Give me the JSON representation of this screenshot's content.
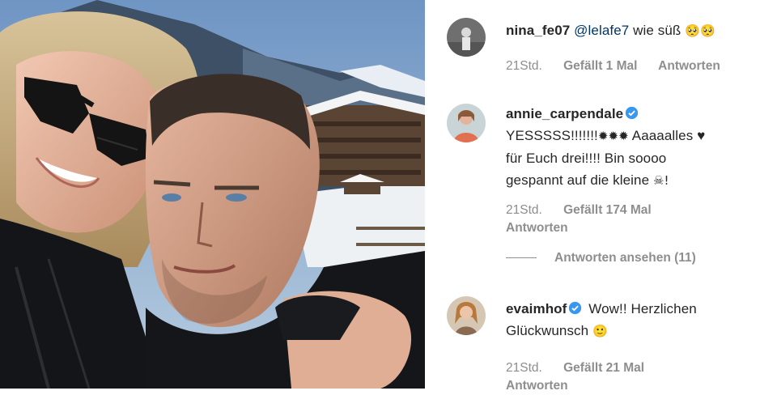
{
  "comments": [
    {
      "username": "nina_fe07",
      "mention": "@lelafe7",
      "text": "wie süß",
      "emoji": "🥺🥺",
      "time": "21Std.",
      "likes": "Gefällt 1 Mal",
      "reply": "Antworten",
      "verified": false
    },
    {
      "username": "annie_carpendale",
      "text_line1": "YESSSSS!!!!!!!",
      "emoji1": "✹✹✹",
      "text_line1b": "Aaaaalles",
      "heart": "♥",
      "text_line2": "für Euch drei!!!! Bin soooo",
      "text_line3": "gespannt auf die kleine",
      "emoji2": "☠!",
      "time": "21Std.",
      "likes": "Gefällt 174 Mal",
      "reply": "Antworten",
      "view_replies": "Antworten ansehen (11)",
      "verified": true
    },
    {
      "username": "evaimhof",
      "text_line1": "Wow!! Herzlichen",
      "text_line2": "Glückwunsch",
      "emoji": "🙂",
      "time": "21Std.",
      "likes": "Gefällt 21 Mal",
      "reply": "Antworten",
      "verified": true
    }
  ],
  "colors": {
    "username": "#262626",
    "mention": "#003569",
    "meta": "#8e8e8e",
    "verified_badge": "#3897f0"
  }
}
